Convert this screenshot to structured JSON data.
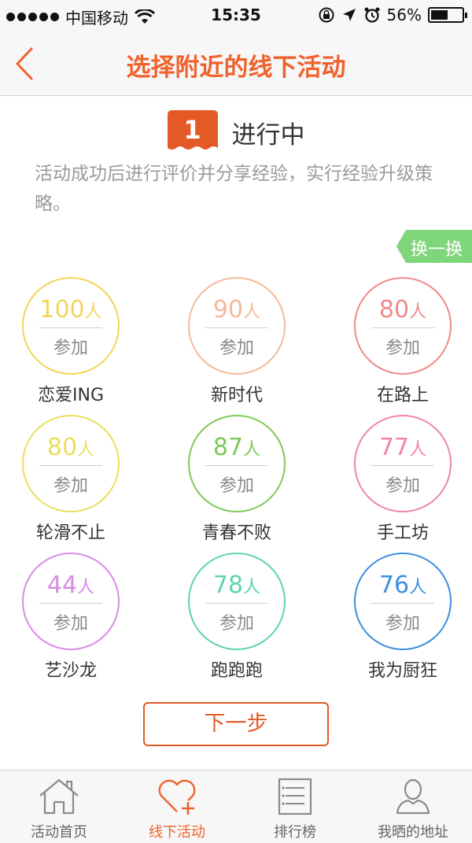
{
  "status_bar": {
    "carrier": "中国移动",
    "time": "15:35",
    "battery_text": "56%",
    "battery_level": 0.56
  },
  "nav": {
    "title": "选择附近的线下活动",
    "back_icon": "chevron-left-icon"
  },
  "step": {
    "number": "1",
    "title": "进行中",
    "description": "活动成功后进行评价并分享经验，实行经验升级策略。"
  },
  "refresh_label": "换一换",
  "colors": {
    "accent": "#f0622b",
    "button": "#e35a27",
    "refresh_tag": "#7fd67a"
  },
  "activities": [
    {
      "count": "100",
      "unit": "人",
      "join": "参加",
      "name": "恋爱ING",
      "color": "#f1d55a"
    },
    {
      "count": "90",
      "unit": "人",
      "join": "参加",
      "name": "新时代",
      "color": "#f5b999"
    },
    {
      "count": "80",
      "unit": "人",
      "join": "参加",
      "name": "在路上",
      "color": "#ef8a8a"
    },
    {
      "count": "80",
      "unit": "人",
      "join": "参加",
      "name": "轮滑不止",
      "color": "#e9df5e"
    },
    {
      "count": "87",
      "unit": "人",
      "join": "参加",
      "name": "青春不败",
      "color": "#7ccb58"
    },
    {
      "count": "77",
      "unit": "人",
      "join": "参加",
      "name": "手工坊",
      "color": "#ef86a6"
    },
    {
      "count": "44",
      "unit": "人",
      "join": "参加",
      "name": "艺沙龙",
      "color": "#d98ae6"
    },
    {
      "count": "78",
      "unit": "人",
      "join": "参加",
      "name": "跑跑跑",
      "color": "#5fd3b0"
    },
    {
      "count": "76",
      "unit": "人",
      "join": "参加",
      "name": "我为厨狂",
      "color": "#3d8fe0"
    }
  ],
  "next_button": "下一步",
  "tabs": [
    {
      "label": "活动首页",
      "icon": "home-icon",
      "active": false
    },
    {
      "label": "线下活动",
      "icon": "heart-plus-icon",
      "active": true
    },
    {
      "label": "排行榜",
      "icon": "ranking-list-icon",
      "active": false
    },
    {
      "label": "我晒的地址",
      "icon": "user-icon",
      "active": false
    }
  ]
}
